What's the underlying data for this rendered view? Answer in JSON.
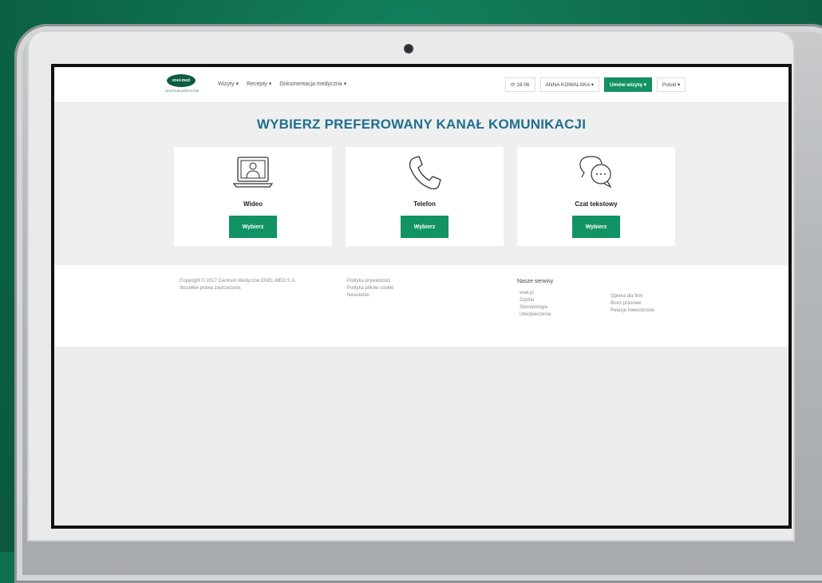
{
  "header": {
    "logo_text": "enel-med",
    "logo_sub": "CENTRUM MEDYCZNE",
    "nav": [
      "Wizyty ▾",
      "Recepty ▾",
      "Dokumentacja medyczna ▾"
    ],
    "time": "⟳ 18:06",
    "user": "ANNA KOWALSKA ▾",
    "book_button": "Umów wizytę ▾",
    "language": "Polski ▾"
  },
  "main": {
    "title": "WYBIERZ PREFEROWANY KANAŁ KOMUNIKACJI",
    "cards": [
      {
        "label": "Wideo",
        "button": "Wybierz",
        "icon": "video-icon"
      },
      {
        "label": "Telefon",
        "button": "Wybierz",
        "icon": "phone-icon"
      },
      {
        "label": "Czat tekstowy",
        "button": "Wybierz",
        "icon": "chat-icon"
      }
    ]
  },
  "footer": {
    "copyright_line1": "Copyright © 2017 Centrum Medyczne ENEL-MED S.A.",
    "copyright_line2": "Wszelkie prawa zastrzeżone.",
    "links": [
      "Polityka prywatności",
      "Polityka plików cookie",
      "Newsletter"
    ],
    "services_heading": "Nasze serwisy",
    "services_col1": [
      "enel.pl",
      "Szpital",
      "Stomatologia",
      "Ubezpieczenia"
    ],
    "services_col2": [
      "Opieka dla firm",
      "Biuro prasowe",
      "Relacje Inwestorskie"
    ]
  },
  "colors": {
    "accent": "#119363",
    "title": "#1f6f8f",
    "background": "#0e6e4e"
  }
}
